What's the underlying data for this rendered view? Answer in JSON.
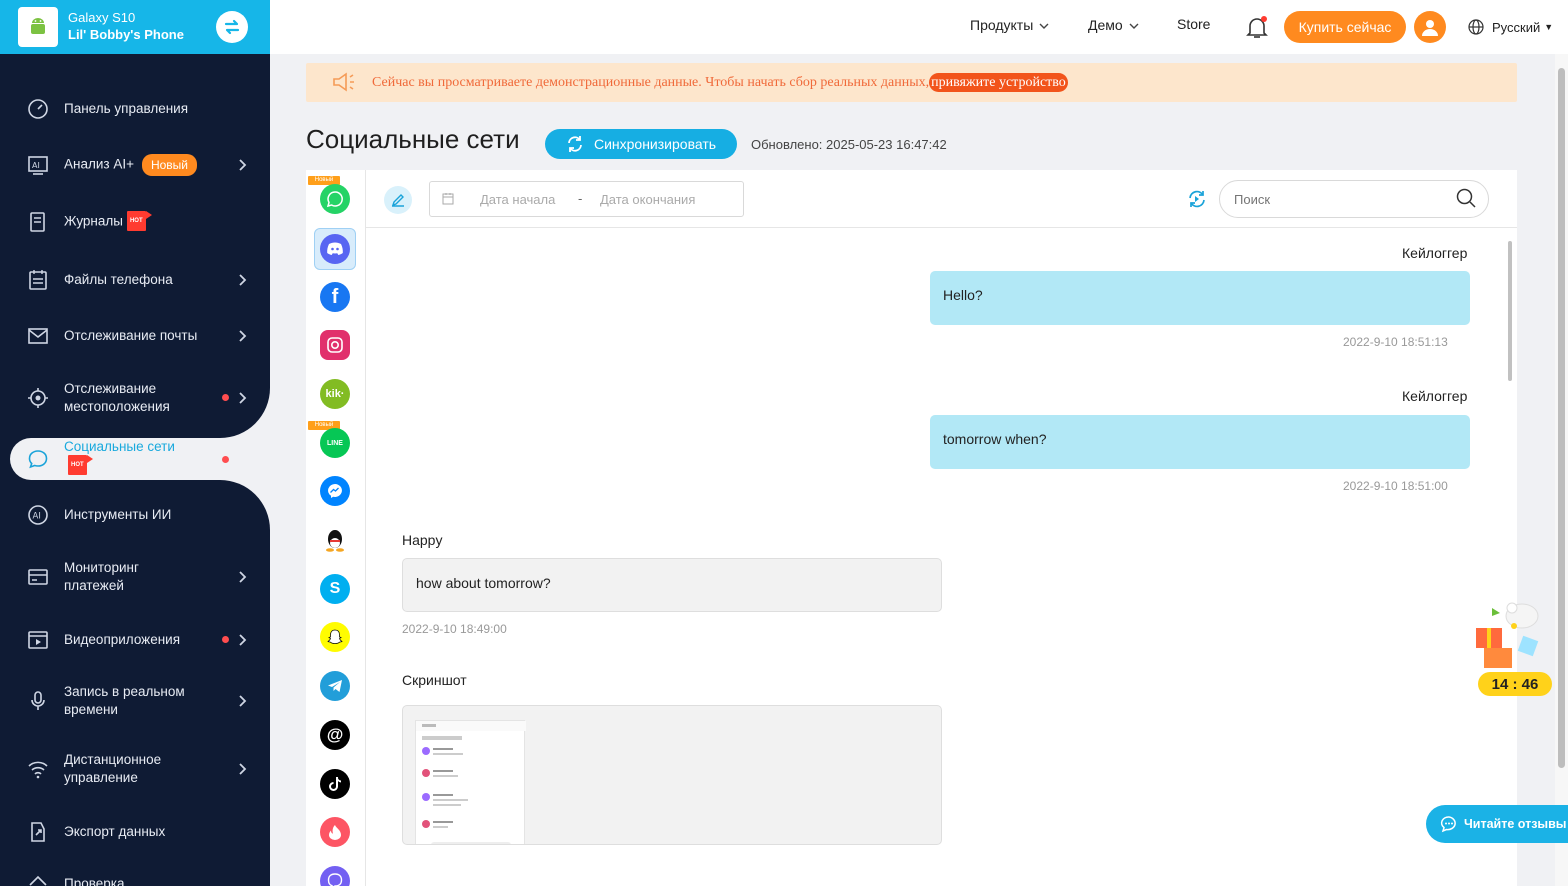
{
  "device": {
    "model": "Galaxy S10",
    "name": "Lil' Bobby's Phone"
  },
  "nav": {
    "dashboard": "Панель управления",
    "ai": "Анализ AI+",
    "ai_badge": "Новый",
    "logs": "Журналы",
    "hot": "HOT",
    "files": "Файлы телефона",
    "mail": "Отслеживание почты",
    "loc1": "Отслеживание",
    "loc2": "местоположения",
    "social": "Социальные сети",
    "aitools": "Инструменты ИИ",
    "pay1": "Мониторинг",
    "pay2": "платежей",
    "video": "Видеоприложения",
    "rec1": "Запись в реальном",
    "rec2": "времени",
    "remote1": "Дистанционное",
    "remote2": "управление",
    "export": "Экспорт данных",
    "check": "Проверка"
  },
  "topbar": {
    "products": "Продукты",
    "demo": "Демо",
    "store": "Store",
    "buy": "Купить сейчас",
    "language": "Русский"
  },
  "banner": {
    "text": "Сейчас вы просматриваете демонстрационные данные. Чтобы начать сбор реальных данных,",
    "link": "привяжите устройство"
  },
  "page": {
    "title": "Социальные сети",
    "sync": "Синхронизировать",
    "updated": "Обновлено: 2025-05-23 16:47:42"
  },
  "apps": {
    "new_tag": "Новый",
    "kik": "kik·"
  },
  "toolbar": {
    "start_date": "Дата начала",
    "dash": "-",
    "end_date": "Дата окончания",
    "search_placeholder": "Поиск"
  },
  "messages": [
    {
      "sender": "Кейлоггер",
      "text": "Hello?",
      "time": "2022-9-10 18:51:13"
    },
    {
      "sender": "Кейлоггер",
      "text": "tomorrow when?",
      "time": "2022-9-10 18:51:00"
    },
    {
      "sender": "Happy",
      "text": "how about tomorrow?",
      "time": "2022-9-10 18:49:00"
    },
    {
      "sender": "Скриншот"
    }
  ],
  "timer": "14 : 46",
  "reviews": "Читайте отзывы"
}
